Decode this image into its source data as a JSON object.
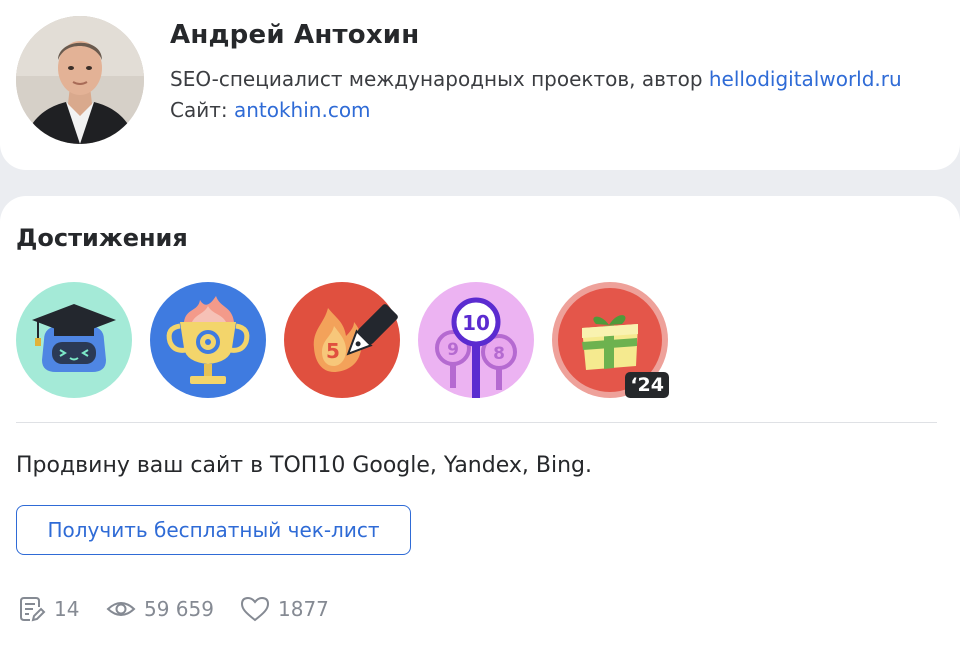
{
  "author": {
    "name": "Андрей Антохин",
    "bio_text": "SEO-специалист международных проектов, автор ",
    "bio_link": "hellodigitalworld.ru",
    "site_label": "Сайт: ",
    "site_link": "antokhin.com"
  },
  "achievements": {
    "title": "Достижения",
    "badges": [
      {
        "icon": "graduation-robot-icon",
        "bg": "#a4ead7"
      },
      {
        "icon": "trophy-icon",
        "bg": "#3f7be0"
      },
      {
        "icon": "fire-pen-icon",
        "bg": "#e0503f",
        "number": "5"
      },
      {
        "icon": "rating-signs-icon",
        "bg": "#ecb3f2",
        "numbers": [
          "10",
          "9",
          "8"
        ]
      },
      {
        "icon": "gift-icon",
        "bg": "#e4564a",
        "year": "‘24"
      }
    ]
  },
  "about": {
    "text": "Продвину ваш сайт в ТОП10 Google, Yandex, Bing."
  },
  "cta": {
    "label": "Получить бесплатный чек-лист"
  },
  "stats": {
    "articles": "14",
    "views": "59 659",
    "likes": "1877"
  },
  "colors": {
    "link": "#2f6bd6",
    "page_bg": "#ebedf1",
    "muted": "#858a93"
  }
}
